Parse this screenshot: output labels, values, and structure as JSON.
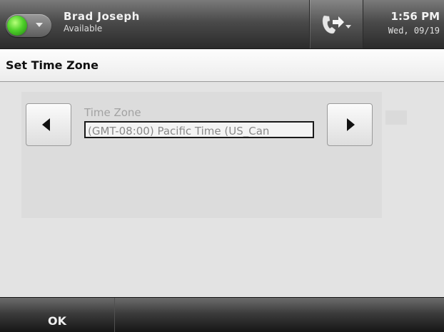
{
  "status_bar": {
    "user_name": "Brad Joseph",
    "presence": "Available",
    "time": "1:56 PM",
    "date": "Wed, 09/19",
    "presence_color": "#4fd12a"
  },
  "page": {
    "title": "Set Time Zone"
  },
  "time_zone": {
    "label": "Time Zone",
    "value": "(GMT-08:00) Pacific Time (US_Can"
  },
  "softkeys": {
    "ok_label": "OK"
  },
  "icons": {
    "presence": "presence-indicator-icon",
    "call": "call-forward-icon",
    "prev": "arrow-left-icon",
    "next": "arrow-right-icon"
  }
}
